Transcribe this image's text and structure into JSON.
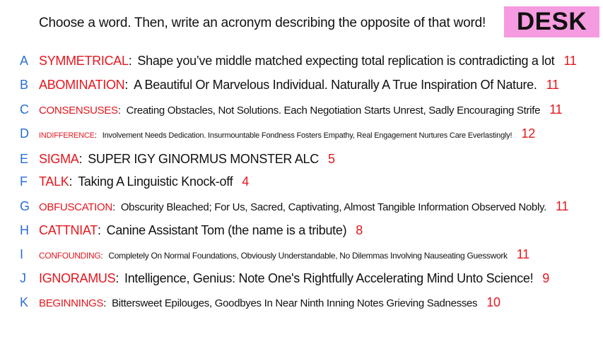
{
  "prompt": "Choose a word. Then, write an acronym describing the opposite of that word!",
  "badge": "DESK",
  "colors": {
    "letter": "#2a6fd6",
    "word": "#e5161e",
    "count": "#e5161e",
    "badge_bg": "#f59be0"
  },
  "entries": [
    {
      "letter": "A",
      "word": "SYMMETRICAL",
      "phrase": "Shape you’ve middle matched expecting total replication is contradicting a lot",
      "count": "11"
    },
    {
      "letter": "B",
      "word": "ABOMINATION",
      "phrase": "A Beautiful Or Marvelous Individual. Naturally A True Inspiration Of Nature.",
      "count": "11"
    },
    {
      "letter": "C",
      "word": "CONSENSUSES",
      "phrase": "Creating Obstacles, Not Solutions. Each Negotiation Starts Unrest, Sadly Encouraging Strife",
      "count": "11"
    },
    {
      "letter": "D",
      "word": "INDIFFERENCE",
      "phrase": "Involvement Needs Dedication. Insurmountable Fondness Fosters Empathy, Real Engagement Nurtures Care Everlastingly!",
      "count": "12"
    },
    {
      "letter": "E",
      "word": "SIGMA",
      "phrase": "SUPER IGY GINORMUS MONSTER ALC",
      "count": "5"
    },
    {
      "letter": "F",
      "word": "TALK",
      "phrase": "Taking A Linguistic Knock-off",
      "count": "4"
    },
    {
      "letter": "G",
      "word": "OBFUSCATION",
      "phrase": "Obscurity Bleached; For Us, Sacred, Captivating, Almost Tangible Information Observed Nobly.",
      "count": "11"
    },
    {
      "letter": "H",
      "word": "CATTNIAT",
      "phrase": "Canine Assistant Tom (the name is a tribute)",
      "count": "8"
    },
    {
      "letter": "I",
      "word": "CONFOUNDING",
      "phrase": "Completely On Normal Foundations, Obviously Understandable, No Dilemmas Involving Nauseating Guesswork",
      "count": "11"
    },
    {
      "letter": "J",
      "word": "IGNORAMUS",
      "phrase": "Intelligence, Genius: Note One's Rightfully Accelerating Mind Unto Science!",
      "count": "9"
    },
    {
      "letter": "K",
      "word": "BEGINNINGS",
      "phrase": "Bittersweet Epilouges, Goodbyes In Near Ninth Inning Notes Grieving Sadnesses",
      "count": "10"
    }
  ]
}
